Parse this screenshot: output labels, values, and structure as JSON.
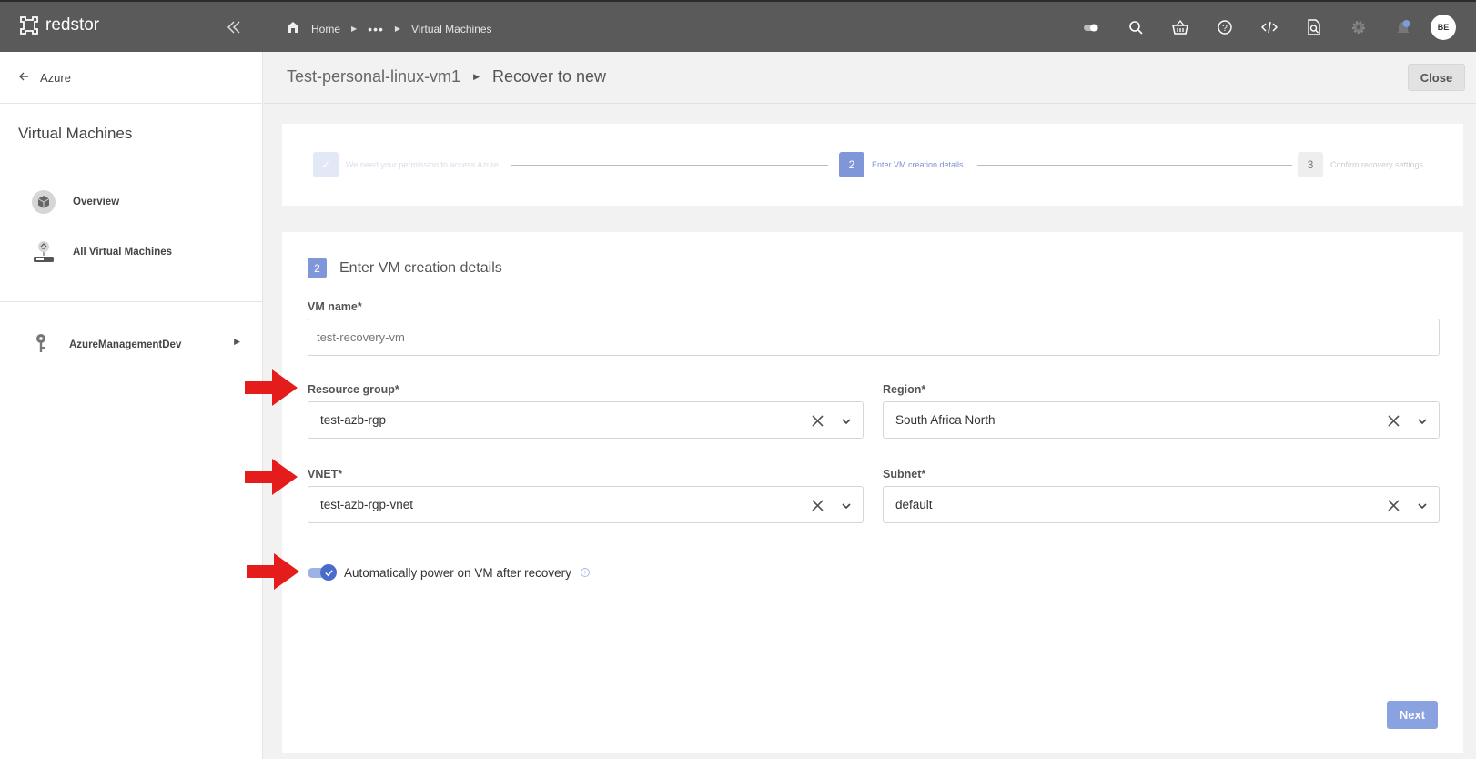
{
  "app": {
    "brand": "redstor"
  },
  "topbar": {
    "breadcrumb": {
      "home": "Home",
      "ellipsis": "•••",
      "current": "Virtual Machines"
    },
    "icons": [
      "toggle-icon",
      "search-icon",
      "basket-icon",
      "help-icon",
      "code-icon",
      "inspect-icon",
      "gear-icon",
      "notification-icon"
    ],
    "avatar_initials": "BE"
  },
  "sidebar": {
    "back_label": "Azure",
    "title": "Virtual Machines",
    "items": [
      {
        "label": "Overview",
        "icon": "overview-icon"
      },
      {
        "label": "All Virtual Machines",
        "icon": "all-vms-icon"
      }
    ],
    "tenant": {
      "label": "AzureManagementDev",
      "icon": "key-icon"
    }
  },
  "header": {
    "vm_name": "Test-personal-linux-vm1",
    "action": "Recover to new",
    "close_label": "Close"
  },
  "stepper": {
    "steps": [
      {
        "number": "✓",
        "label": "We need your permission to access Azure",
        "state": "done"
      },
      {
        "number": "2",
        "label": "Enter VM creation details",
        "state": "active"
      },
      {
        "number": "3",
        "label": "Confirm recovery settings",
        "state": "pending"
      }
    ]
  },
  "form": {
    "step_number": "2",
    "title": "Enter VM creation details",
    "vm_name": {
      "label": "VM name*",
      "value": "test-recovery-vm"
    },
    "resource_group": {
      "label": "Resource group*",
      "value": "test-azb-rgp"
    },
    "region": {
      "label": "Region*",
      "value": "South Africa North"
    },
    "vnet": {
      "label": "VNET*",
      "value": "test-azb-rgp-vnet"
    },
    "subnet": {
      "label": "Subnet*",
      "value": "default"
    },
    "auto_power_on": {
      "label": "Automatically power on VM after recovery",
      "checked": true
    },
    "info_glyph": "i",
    "next_label": "Next"
  },
  "colors": {
    "accent": "#7f96d9",
    "annotation_arrow": "#e41c1c",
    "topbar": "#5a5a5a"
  }
}
